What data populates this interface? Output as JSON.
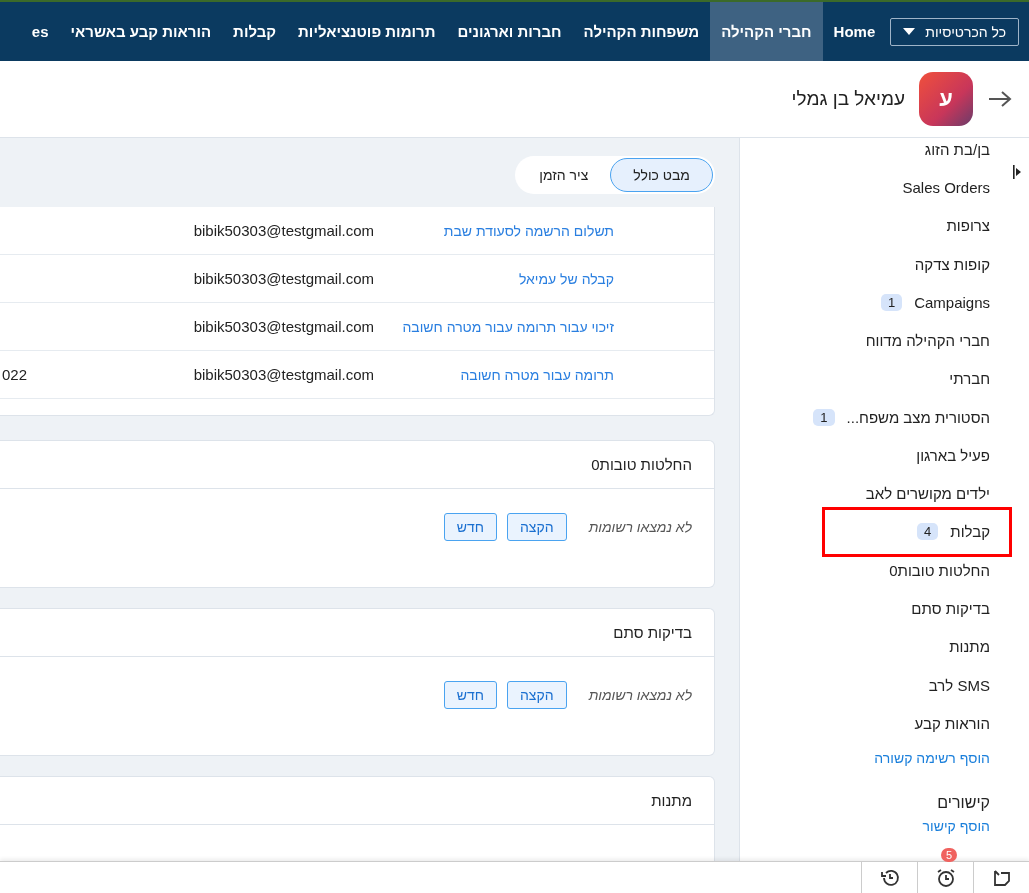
{
  "nav": {
    "dropdown": "כל הכרטיסיות",
    "items": [
      {
        "label": "Home",
        "selected": false
      },
      {
        "label": "חברי הקהילה",
        "selected": true
      },
      {
        "label": "משפחות הקהילה",
        "selected": false
      },
      {
        "label": "חברות וארגונים",
        "selected": false
      },
      {
        "label": "תרומות פוטנציאליות",
        "selected": false
      },
      {
        "label": "קבלות",
        "selected": false
      },
      {
        "label": "הוראות קבע באשראי",
        "selected": false
      },
      {
        "label": "es",
        "selected": false
      }
    ]
  },
  "record": {
    "avatar_letter": "ע",
    "name": "עמיאל בן גמלי"
  },
  "view_toggle": [
    {
      "label": "מבט כולל",
      "selected": true
    },
    {
      "label": "ציר הזמן",
      "selected": false
    }
  ],
  "receipts_table": {
    "rows": [
      {
        "name": "תשלום הרשמה לסעודת שבת",
        "email": "bibik50303@testgmail.com"
      },
      {
        "name": "קבלה של עמיאל",
        "email": "bibik50303@testgmail.com"
      },
      {
        "name": "זיכוי עבור תרומה עבור מטרה חשובה",
        "email": "bibik50303@testgmail.com"
      },
      {
        "name": "תרומה עבור מטרה חשובה",
        "email": "bibik50303@testgmail.com",
        "column_3": "022"
      }
    ]
  },
  "cards": [
    {
      "title": "החלטות טובות0",
      "empty_text": "לא נמצאו רשומות",
      "buttons": [
        "הקצה",
        "חדש"
      ]
    },
    {
      "title": "בדיקות סתם",
      "empty_text": "לא נמצאו רשומות",
      "buttons": [
        "הקצה",
        "חדש"
      ]
    },
    {
      "title": "מתנות"
    }
  ],
  "sidebar": {
    "items": [
      {
        "label": "בן/בת הזוג",
        "highlighted": false
      },
      {
        "label": "Sales Orders",
        "highlighted": false
      },
      {
        "label": "צרופות",
        "highlighted": false
      },
      {
        "label": "קופות צדקה",
        "highlighted": false
      },
      {
        "label": "Campaigns",
        "count": "1",
        "highlighted": false
      },
      {
        "label": "חברי הקהילה מדווח",
        "highlighted": false
      },
      {
        "label": "חברתי",
        "highlighted": false
      },
      {
        "label": "הסטורית מצב משפח...",
        "count": "1",
        "highlighted": false
      },
      {
        "label": "פעיל בארגון",
        "highlighted": false
      },
      {
        "label": "ילדים מקושרים לאב",
        "highlighted": false
      },
      {
        "label": "קבלות",
        "count": "4",
        "highlighted": true
      },
      {
        "label": "החלטות טובות0",
        "highlighted": false
      },
      {
        "label": "בדיקות סתם",
        "highlighted": false
      },
      {
        "label": "מתנות",
        "highlighted": false
      },
      {
        "label": "SMS לרב",
        "highlighted": false
      },
      {
        "label": "הוראות קבע",
        "highlighted": false
      }
    ],
    "add_list_link": "הוסף רשימה קשורה",
    "links_heading": "קישורים",
    "add_link": "הוסף קישור"
  },
  "bottom_bar": {
    "reminder_count": "5"
  }
}
